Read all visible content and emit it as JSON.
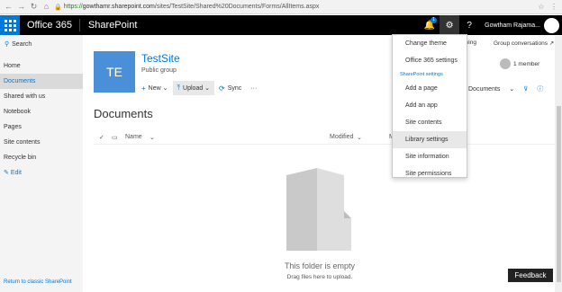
{
  "browser": {
    "url_scheme": "https://",
    "url_host": "gowthamr.sharepoint.com",
    "url_path": "/sites/TestSite/Shared%20Documents/Forms/AllItems.aspx"
  },
  "suite": {
    "app": "Office 365",
    "product": "SharePoint",
    "notification_count": "1",
    "user_name": "Gowtham Rajama..."
  },
  "left_nav": {
    "search_label": "Search",
    "items": [
      {
        "label": "Home"
      },
      {
        "label": "Documents"
      },
      {
        "label": "Shared with us"
      },
      {
        "label": "Notebook"
      },
      {
        "label": "Pages"
      },
      {
        "label": "Site contents"
      },
      {
        "label": "Recycle bin"
      }
    ],
    "edit_label": "Edit",
    "classic_link": "Return to classic SharePoint"
  },
  "site": {
    "logo_initials": "TE",
    "name": "TestSite",
    "subtitle": "Public group",
    "following": "owing",
    "group_conversations": "Group conversations ↗",
    "members": "1 member"
  },
  "command_bar": {
    "new": "New",
    "upload": "Upload",
    "sync": "Sync",
    "more": "···",
    "view": "Documents"
  },
  "main": {
    "title": "Documents",
    "col_name": "Name",
    "col_modified": "Modified",
    "col_partial": "M",
    "empty_title": "This folder is empty",
    "empty_sub": "Drag files here to upload.",
    "feedback": "Feedback"
  },
  "settings_menu": {
    "items_top": [
      {
        "label": "Change theme"
      },
      {
        "label": "Office 365 settings"
      }
    ],
    "section": "SharePoint settings",
    "items_sp": [
      {
        "label": "Add a page"
      },
      {
        "label": "Add an app"
      },
      {
        "label": "Site contents"
      },
      {
        "label": "Library settings"
      },
      {
        "label": "Site information"
      },
      {
        "label": "Site permissions"
      }
    ]
  },
  "colors": {
    "accent": "#0078d7",
    "suite_bar": "#000000",
    "site_logo": "#4a90d9"
  }
}
